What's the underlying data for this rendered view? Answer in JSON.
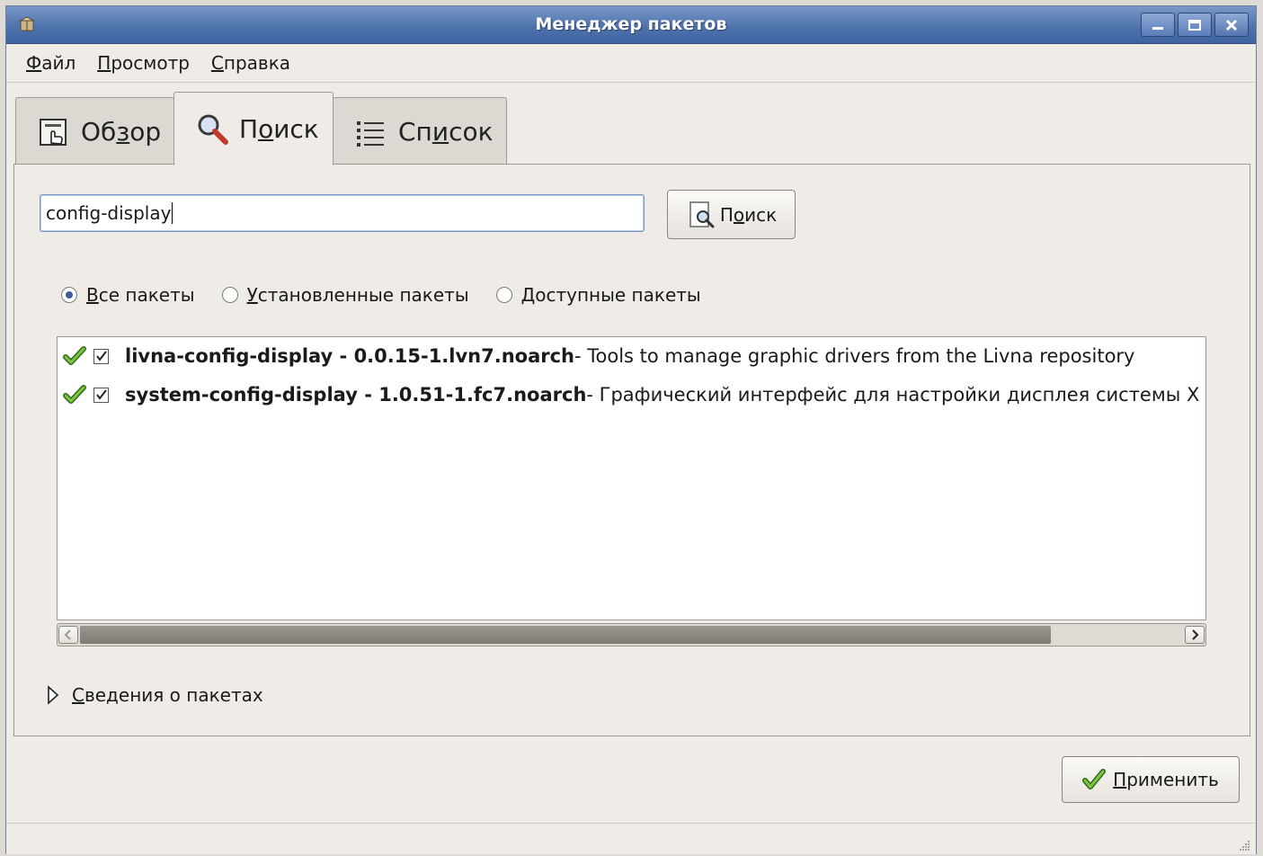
{
  "window": {
    "title": "Менеджер пакетов",
    "controls": [
      "minimize",
      "maximize",
      "close"
    ]
  },
  "menu": {
    "file": {
      "pre": "",
      "key": "Ф",
      "post": "айл"
    },
    "view": {
      "pre": "",
      "key": "П",
      "post": "росмотр"
    },
    "help": {
      "pre": "",
      "key": "С",
      "post": "правка"
    }
  },
  "tabs": {
    "overview": {
      "pre": "Об",
      "key": "з",
      "post": "ор",
      "icon": "overview-icon"
    },
    "search": {
      "pre": "П",
      "key": "о",
      "post": "иск",
      "icon": "magnifier-icon",
      "active": true
    },
    "list": {
      "pre": "Сп",
      "key": "и",
      "post": "сок",
      "icon": "list-icon"
    }
  },
  "search": {
    "query": "config-display",
    "button": {
      "pre": "П",
      "key": "о",
      "post": "иск"
    }
  },
  "filters": {
    "all": {
      "key": "В",
      "post": "се пакеты",
      "selected": true
    },
    "installed": {
      "key": "У",
      "post": "становленные пакеты",
      "selected": false
    },
    "available": {
      "key": "Д",
      "post": "оступные пакеты",
      "selected": false
    }
  },
  "packages": [
    {
      "name": "livna-config-display - 0.0.15-1.lvn7.noarch",
      "desc": " - Tools to manage graphic drivers from the Livna repository",
      "installed": true,
      "checked": true
    },
    {
      "name": "system-config-display - 1.0.51-1.fc7.noarch",
      "desc": " - Графический интерфейс для настройки дисплея системы X Window",
      "installed": true,
      "checked": true
    }
  ],
  "scrollbar": {
    "position": 0.0,
    "visible_fraction": 0.85
  },
  "details": {
    "key": "С",
    "post": "ведения о пакетах",
    "expanded": false
  },
  "apply": {
    "key": "П",
    "post": "рименить"
  },
  "colors": {
    "titlebar": "#4f73ad",
    "selection_accent": "#3d5f9c",
    "installed_check": "#5aa02c"
  }
}
